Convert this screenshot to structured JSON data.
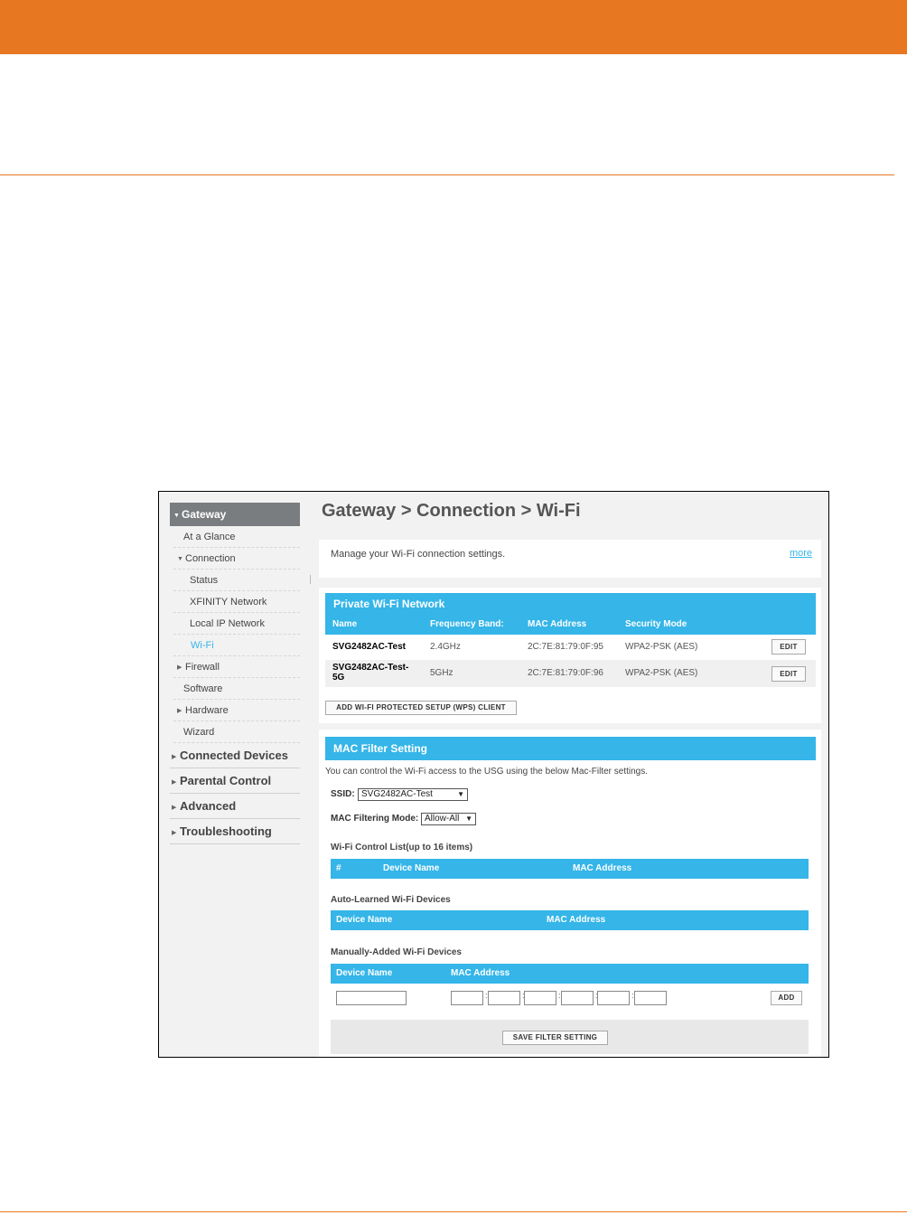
{
  "breadcrumb": "Gateway > Connection > Wi-Fi",
  "sidebar": {
    "gateway": "Gateway",
    "items": [
      {
        "label": "At a Glance"
      },
      {
        "label": "Connection"
      },
      {
        "label": "Status"
      },
      {
        "label": "XFINITY Network"
      },
      {
        "label": "Local IP Network"
      },
      {
        "label": "Wi-Fi"
      },
      {
        "label": "Firewall"
      },
      {
        "label": "Software"
      },
      {
        "label": "Hardware"
      },
      {
        "label": "Wizard"
      }
    ],
    "main": [
      {
        "label": "Connected Devices"
      },
      {
        "label": "Parental Control"
      },
      {
        "label": "Advanced"
      },
      {
        "label": "Troubleshooting"
      }
    ]
  },
  "info": {
    "text": "Manage your Wi-Fi connection settings.",
    "more": "more"
  },
  "wifi": {
    "title": "Private Wi-Fi Network",
    "columns": {
      "name": "Name",
      "band": "Frequency Band:",
      "mac": "MAC Address",
      "security": "Security Mode"
    },
    "rows": [
      {
        "name": "SVG2482AC-Test",
        "band": "2.4GHz",
        "mac": "2C:7E:81:79:0F:95",
        "security": "WPA2-PSK (AES)",
        "edit": "EDIT"
      },
      {
        "name_line1": "SVG2482AC-Test-",
        "name_line2": "5G",
        "band": "5GHz",
        "mac": "2C:7E:81:79:0F:96",
        "security": "WPA2-PSK (AES)",
        "edit": "EDIT"
      }
    ],
    "wps_button": "ADD WI-FI PROTECTED SETUP (WPS) CLIENT"
  },
  "mac_filter": {
    "title": "MAC Filter Setting",
    "description": "You can control the Wi-Fi access to the USG using the below Mac-Filter settings.",
    "ssid_label": "SSID:",
    "ssid_value": "SVG2482AC-Test",
    "mode_label": "MAC Filtering Mode:",
    "mode_value": "Allow-All",
    "control_list": {
      "title": "Wi-Fi Control List(up to 16 items)",
      "col_num": "#",
      "col_device": "Device Name",
      "col_mac": "MAC Address"
    },
    "auto_learned": {
      "title": "Auto-Learned Wi-Fi Devices",
      "col_device": "Device Name",
      "col_mac": "MAC Address"
    },
    "manual": {
      "title": "Manually-Added Wi-Fi Devices",
      "col_device": "Device Name",
      "col_mac": "MAC Address",
      "separator": ":",
      "add_button": "ADD"
    },
    "save_button": "SAVE FILTER SETTING"
  }
}
